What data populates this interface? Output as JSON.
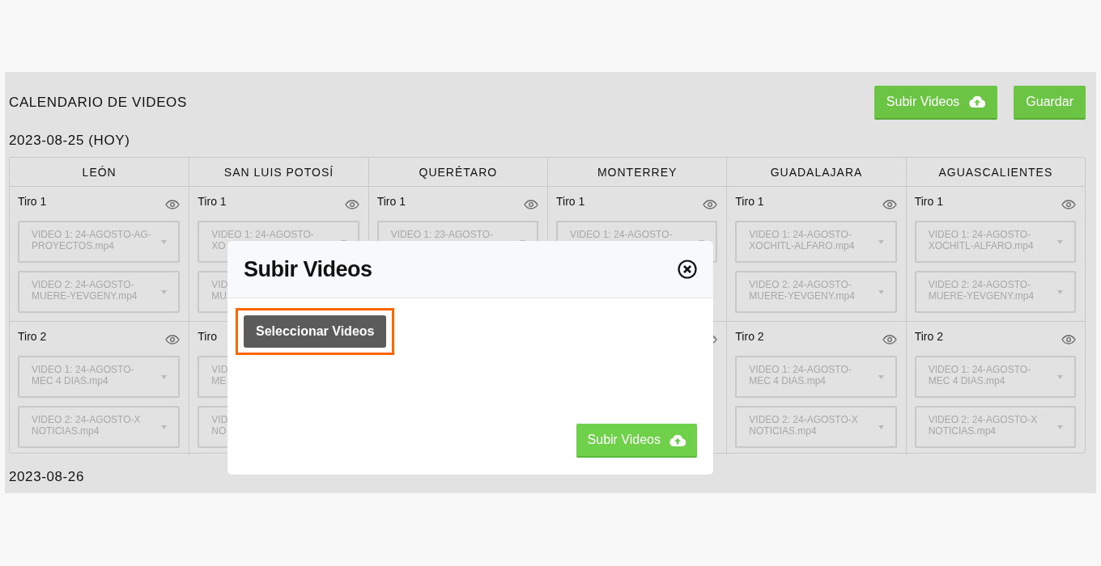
{
  "header": {
    "title": "CALENDARIO DE VIDEOS",
    "buttons": [
      {
        "label": "Subir Videos",
        "kind": "upload"
      },
      {
        "label": "Guardar",
        "kind": "plain"
      }
    ]
  },
  "days": [
    {
      "date": "2023-08-25 (HOY)",
      "columns": [
        {
          "city": "LEÓN",
          "tiros": [
            {
              "label": "Tiro 1",
              "eye": true,
              "videos": [
                "VIDEO 1: 24-AGOSTO-AG-\nPROYECTOS.mp4",
                "VIDEO 2: 24-AGOSTO-\nMUERE-YEVGENY.mp4"
              ]
            },
            {
              "label": "Tiro 2",
              "eye": true,
              "videos": [
                "VIDEO 1: 24-AGOSTO-\nMEC 4 DIAS.mp4",
                "VIDEO 2: 24-AGOSTO-X\nNOTICIAS.mp4"
              ]
            }
          ]
        },
        {
          "city": "SAN LUIS POTOSÍ",
          "tiros": [
            {
              "label": "Tiro 1",
              "eye": true,
              "videos": [
                "VIDEO 1: 24-AGOSTO-\nXO",
                "VID\nMU"
              ]
            },
            {
              "label": "Tiro",
              "eye": false,
              "videos": [
                "VID\nME",
                "VID\nNO"
              ]
            }
          ]
        },
        {
          "city": "QUERÉTARO",
          "tiros": [
            {
              "label": "Tiro 1",
              "eye": true,
              "videos": [
                "VIDEO 1: 23-AGOSTO-"
              ]
            }
          ]
        },
        {
          "city": "MONTERREY",
          "tiros": [
            {
              "label": "Tiro 1",
              "eye": true,
              "videos": [
                "VIDEO 1: 24-AGOSTO-"
              ]
            },
            {
              "eye": true
            }
          ]
        },
        {
          "city": "GUADALAJARA",
          "tiros": [
            {
              "label": "Tiro 1",
              "eye": true,
              "videos": [
                "VIDEO 1: 24-AGOSTO-\nXOCHITL-ALFARO.mp4",
                "VIDEO 2: 24-AGOSTO-\nMUERE-YEVGENY.mp4"
              ]
            },
            {
              "label": "Tiro 2",
              "eye": true,
              "videos": [
                "VIDEO 1: 24-AGOSTO-\nMEC 4 DIAS.mp4",
                "VIDEO 2: 24-AGOSTO-X\nNOTICIAS.mp4"
              ]
            }
          ]
        },
        {
          "city": "AGUASCALIENTES",
          "tiros": [
            {
              "label": "Tiro 1",
              "eye": true,
              "videos": [
                "VIDEO 1: 24-AGOSTO-\nXOCHITL-ALFARO.mp4",
                "VIDEO 2: 24-AGOSTO-\nMUERE-YEVGENY.mp4"
              ]
            },
            {
              "label": "Tiro 2",
              "eye": true,
              "videos": [
                "VIDEO 1: 24-AGOSTO-\nMEC 4 DIAS.mp4",
                "VIDEO 2: 24-AGOSTO-X\nNOTICIAS.mp4"
              ]
            }
          ]
        }
      ]
    },
    {
      "date": "2023-08-26"
    }
  ],
  "modal": {
    "title": "Subir Videos",
    "select_button": "Seleccionar Videos",
    "highlighted": true,
    "submit_button": "Subir Videos"
  }
}
